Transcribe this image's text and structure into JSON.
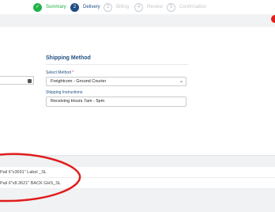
{
  "stepper": {
    "steps": [
      {
        "number": "✓",
        "label": "Summary",
        "state": "done"
      },
      {
        "number": "2",
        "label": "Delivery",
        "state": "active"
      },
      {
        "number": "3",
        "label": "Billing",
        "state": "pending"
      },
      {
        "number": "4",
        "label": "Review",
        "state": "pending"
      },
      {
        "number": "5",
        "label": "Confirmation",
        "state": "pending"
      }
    ]
  },
  "shipping": {
    "title": "Shipping Method",
    "select_label": "Select Method",
    "required_mark": "*",
    "selected_method": "Freightcom - Ground Courier",
    "instructions_label": "Shipping Instructions",
    "instructions_value": "Receiving Hours 7am - 5pm"
  },
  "items": {
    "rows": [
      {
        "text": "Pail 6\"x3691\" Label _SL"
      },
      {
        "text": "Pail 6\"x8.3621\" BACK GHS_SL"
      }
    ]
  },
  "colors": {
    "accent": "#1f4f82",
    "success": "#21b34a",
    "annotation": "#e01d1d"
  }
}
